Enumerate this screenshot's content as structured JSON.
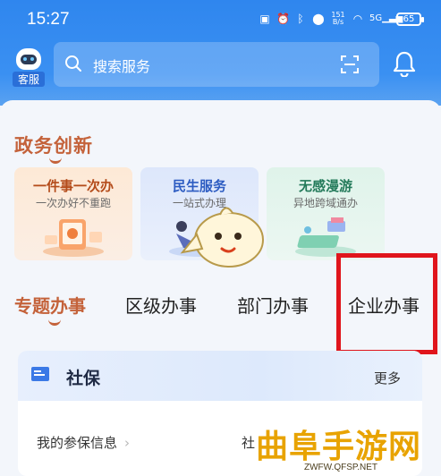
{
  "status_bar": {
    "time": "15:27",
    "network_speed_value": "151",
    "network_speed_unit": "B/s",
    "signal_label": "5G",
    "battery": "65"
  },
  "header": {
    "service_label": "客服",
    "search_placeholder": "搜索服务"
  },
  "section": {
    "title": "政务创新"
  },
  "cards": [
    {
      "title": "一件事一次办",
      "subtitle": "一次办好不重跑"
    },
    {
      "title": "民生服务",
      "subtitle": "一站式办理"
    },
    {
      "title": "无感漫游",
      "subtitle": "异地跨域通办"
    }
  ],
  "tabs": [
    {
      "label": "专题办事",
      "active": true
    },
    {
      "label": "区级办事",
      "active": false
    },
    {
      "label": "部门办事",
      "active": false
    },
    {
      "label": "企业办事",
      "active": false
    }
  ],
  "social": {
    "title": "社保",
    "more": "更多",
    "items": [
      {
        "label": "我的参保信息"
      },
      {
        "label": "社"
      }
    ]
  },
  "watermark": {
    "text": "曲阜手游网",
    "url": "ZWFW.QFSP.NET"
  },
  "colors": {
    "header_blue": "#3a90f2",
    "accent_orange": "#c4623a",
    "highlight_red": "#e0151c",
    "watermark_gold": "#e8a300"
  }
}
